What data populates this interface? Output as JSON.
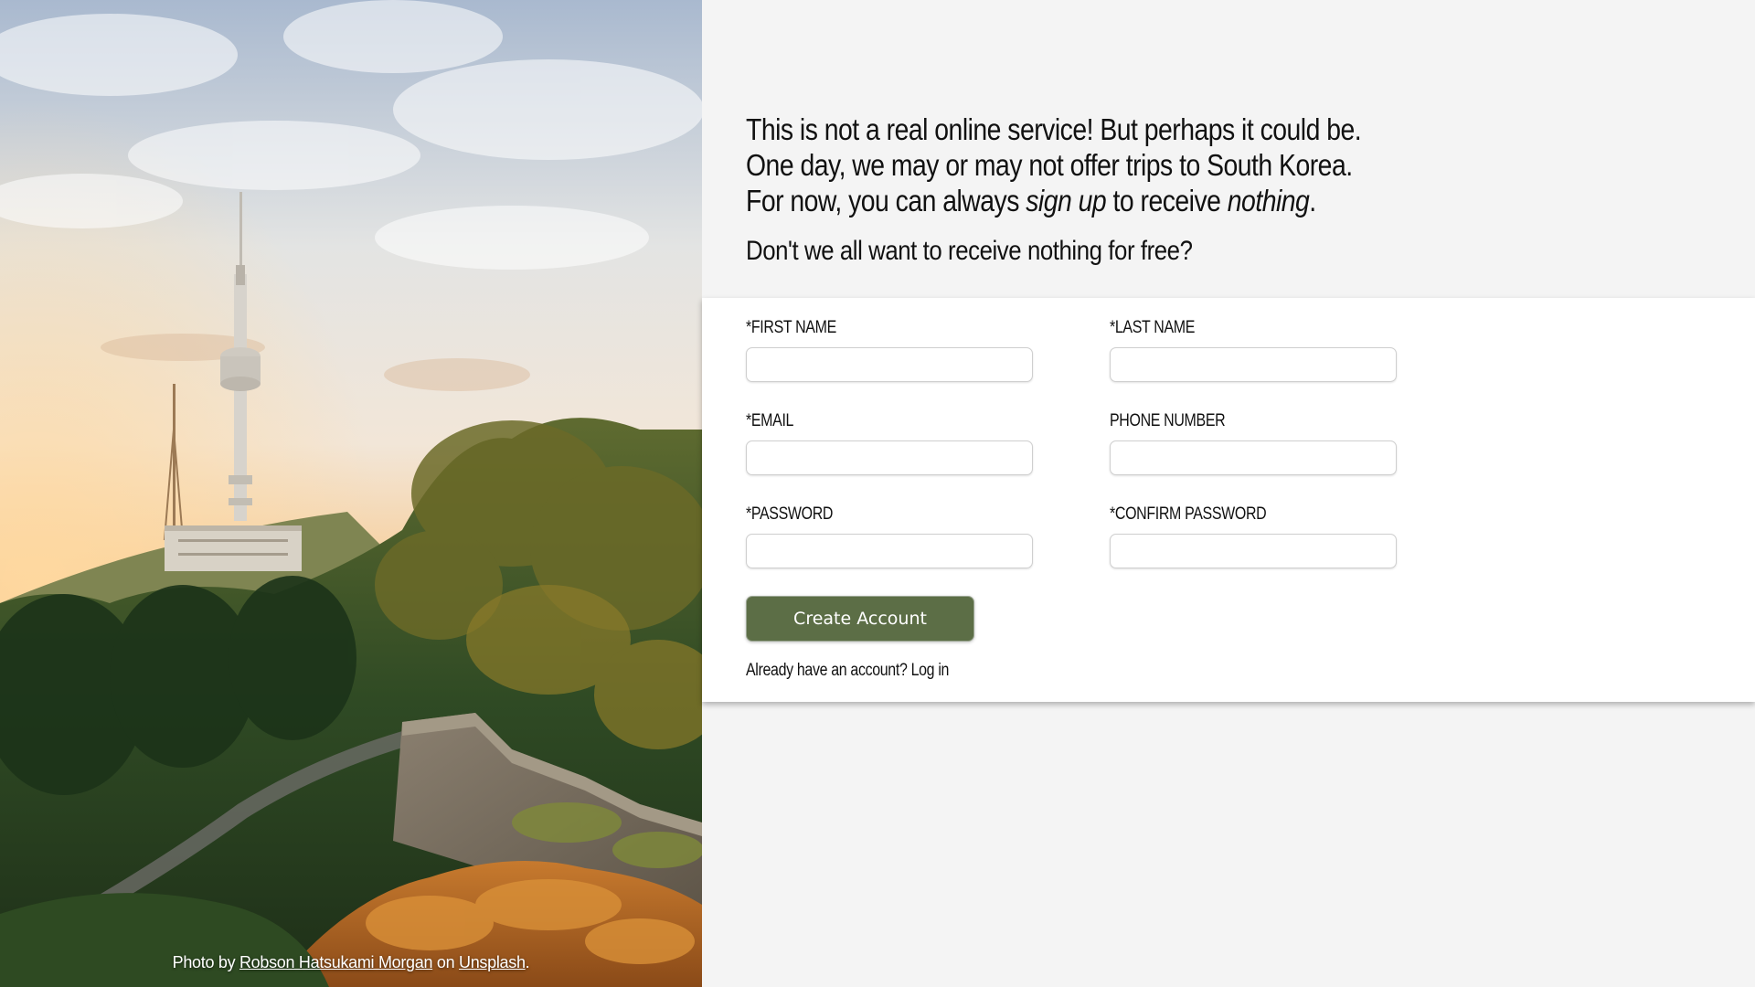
{
  "photo": {
    "credit_prefix": "Photo by ",
    "photographer": "Robson Hatsukami Morgan",
    "credit_middle": " on ",
    "source": "Unsplash",
    "credit_suffix": "."
  },
  "intro": {
    "line1": "This is not a real online service! But perhaps it could be.",
    "line2": "One day, we may or may not offer trips to South Korea.",
    "line3_a": "For now, you can always ",
    "line3_em1": "sign up",
    "line3_b": " to receive ",
    "line3_em2": "nothing",
    "line3_c": ".",
    "question": "Don't we all want to receive nothing for free?"
  },
  "form": {
    "first_name_label": "*FIRST NAME",
    "last_name_label": "*LAST NAME",
    "email_label": "*EMAIL",
    "phone_label": "PHONE NUMBER",
    "password_label": "*PASSWORD",
    "confirm_password_label": "*CONFIRM PASSWORD",
    "first_name_value": "",
    "last_name_value": "",
    "email_value": "",
    "phone_value": "",
    "password_value": "",
    "confirm_password_value": "",
    "submit_label": "Create Account",
    "login_prompt": "Already have an account? ",
    "login_link": "Log in"
  },
  "colors": {
    "button": "#5c6e46",
    "page_background": "#f4f4f4",
    "card_background": "#ffffff"
  }
}
